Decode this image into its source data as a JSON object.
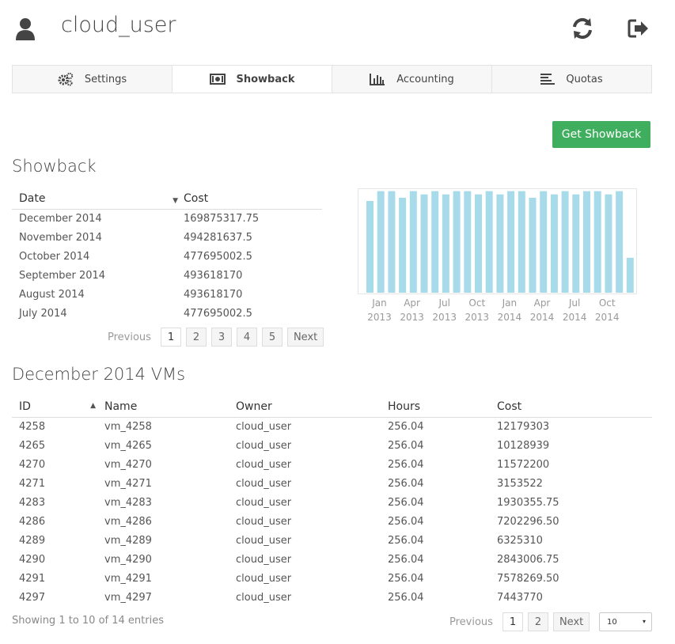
{
  "header": {
    "username": "cloud_user"
  },
  "tabs": [
    {
      "label": "Settings",
      "icon": "gears-icon"
    },
    {
      "label": "Showback",
      "icon": "money-icon",
      "active": true
    },
    {
      "label": "Accounting",
      "icon": "bar-chart-icon"
    },
    {
      "label": "Quotas",
      "icon": "align-left-icon"
    }
  ],
  "get_showback_label": "Get Showback",
  "showback": {
    "title": "Showback",
    "columns": [
      "Date",
      "Cost"
    ],
    "rows": [
      [
        "December 2014",
        "169875317.75"
      ],
      [
        "November 2014",
        "494281637.5"
      ],
      [
        "October 2014",
        "477695002.5"
      ],
      [
        "September 2014",
        "493618170"
      ],
      [
        "August 2014",
        "493618170"
      ],
      [
        "July 2014",
        "477695002.5"
      ]
    ],
    "pager": {
      "previous": "Previous",
      "pages": [
        "1",
        "2",
        "3",
        "4",
        "5"
      ],
      "next": "Next"
    }
  },
  "chart_data": {
    "type": "bar",
    "x_tick_labels": [
      "Jan\n2013",
      "Apr\n2013",
      "Jul\n2013",
      "Oct\n2013",
      "Jan\n2014",
      "Apr\n2014",
      "Jul\n2014",
      "Oct\n2014"
    ],
    "values": [
      446,
      494,
      494,
      462,
      494,
      478,
      494,
      478,
      494,
      494,
      478,
      494,
      478,
      494,
      494,
      462,
      494,
      478,
      494,
      478,
      494,
      494,
      478,
      494,
      170
    ],
    "ylim": [
      0,
      500
    ],
    "grid": false,
    "bar_color": "#a8dbe9"
  },
  "vms": {
    "title": "December 2014 VMs",
    "columns": [
      "ID",
      "Name",
      "Owner",
      "Hours",
      "Cost"
    ],
    "rows": [
      [
        "4258",
        "vm_4258",
        "cloud_user",
        "256.04",
        "12179303"
      ],
      [
        "4265",
        "vm_4265",
        "cloud_user",
        "256.04",
        "10128939"
      ],
      [
        "4270",
        "vm_4270",
        "cloud_user",
        "256.04",
        "11572200"
      ],
      [
        "4271",
        "vm_4271",
        "cloud_user",
        "256.04",
        "3153522"
      ],
      [
        "4283",
        "vm_4283",
        "cloud_user",
        "256.04",
        "1930355.75"
      ],
      [
        "4286",
        "vm_4286",
        "cloud_user",
        "256.04",
        "7202296.50"
      ],
      [
        "4289",
        "vm_4289",
        "cloud_user",
        "256.04",
        "6325310"
      ],
      [
        "4290",
        "vm_4290",
        "cloud_user",
        "256.04",
        "2843006.75"
      ],
      [
        "4291",
        "vm_4291",
        "cloud_user",
        "256.04",
        "7578269.50"
      ],
      [
        "4297",
        "vm_4297",
        "cloud_user",
        "256.04",
        "7443770"
      ]
    ],
    "info": "Showing 1 to 10 of 14 entries",
    "pager": {
      "previous": "Previous",
      "pages": [
        "1",
        "2"
      ],
      "next": "Next"
    },
    "page_size": "10"
  }
}
